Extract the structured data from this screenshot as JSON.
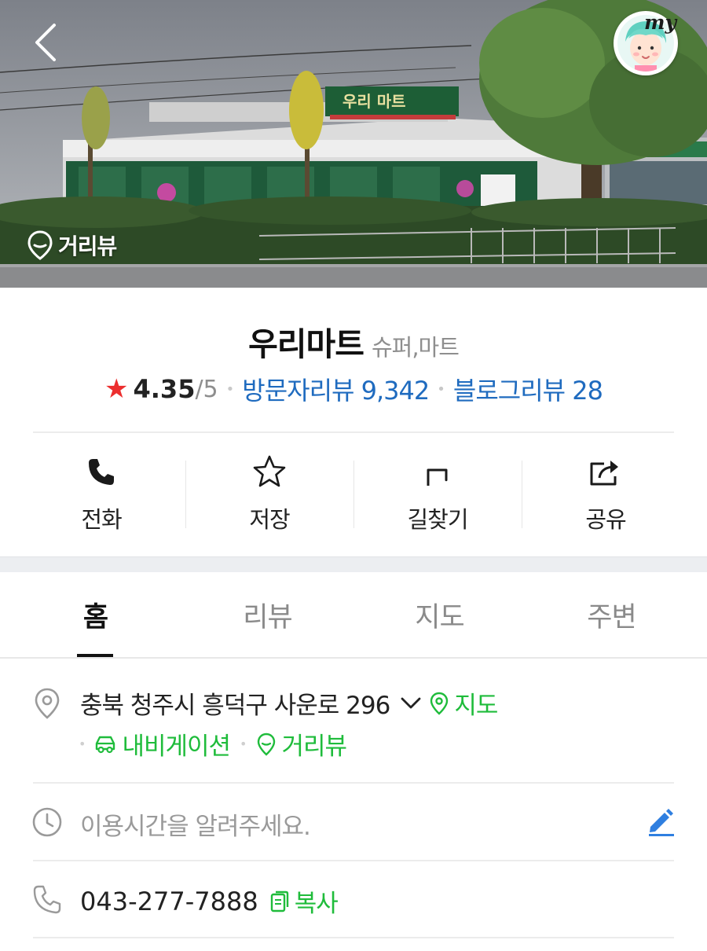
{
  "hero": {
    "back_icon": "chevron-left-icon",
    "my_label": "my",
    "street_view_label": "거리뷰",
    "street_view_icon": "location-pin-icon"
  },
  "place": {
    "name": "우리마트",
    "category": "슈퍼,마트",
    "rating": "4.35",
    "rating_max": "/5",
    "visitor_reviews": "방문자리뷰 9,342",
    "blog_reviews": "블로그리뷰 28"
  },
  "actions": [
    {
      "label": "전화",
      "icon": "phone-icon"
    },
    {
      "label": "저장",
      "icon": "star-outline-icon"
    },
    {
      "label": "길찾기",
      "icon": "directions-icon"
    },
    {
      "label": "공유",
      "icon": "share-icon"
    }
  ],
  "tabs": [
    {
      "label": "홈",
      "active": true
    },
    {
      "label": "리뷰",
      "active": false
    },
    {
      "label": "지도",
      "active": false
    },
    {
      "label": "주변",
      "active": false
    }
  ],
  "info": {
    "address": "충북 청주시 흥덕구 사운로 296",
    "map_link": "지도",
    "navigation_link": "내비게이션",
    "street_view_link": "거리뷰",
    "hours_placeholder": "이용시간을 알려주세요.",
    "phone": "043-277-7888",
    "copy_label": "복사"
  },
  "colors": {
    "accent_green": "#1fbc3b",
    "link_blue": "#1f6bbf",
    "star_red": "#ec2e2e",
    "edit_blue": "#2f7fe0"
  }
}
